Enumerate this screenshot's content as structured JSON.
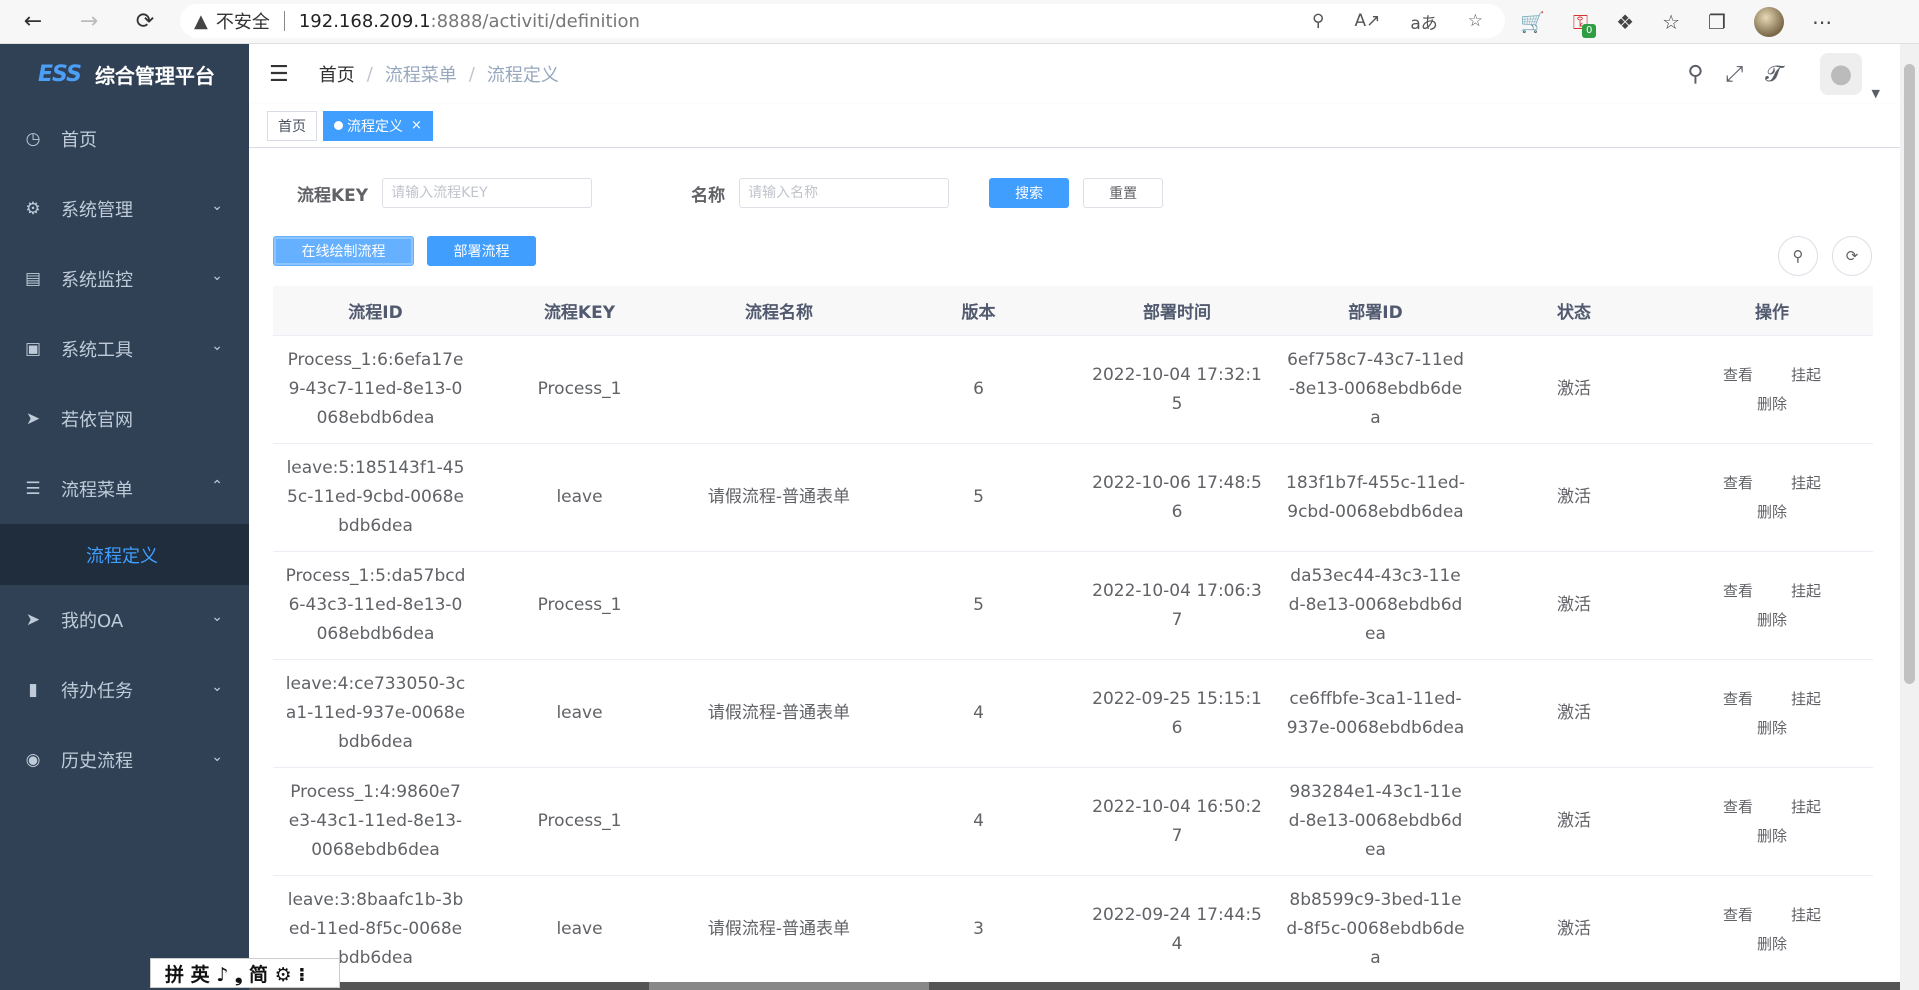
{
  "browser": {
    "insecure_label": "不安全",
    "url_host": "192.168.209.1",
    "url_rest": ":8888/activiti/definition",
    "ext_badge_count": "0"
  },
  "sidebar": {
    "logo_mark": "ESS",
    "logo_text": "综合管理平台",
    "items": [
      {
        "label": "首页",
        "icon": "dashboard-icon"
      },
      {
        "label": "系统管理",
        "icon": "gear-icon"
      },
      {
        "label": "系统监控",
        "icon": "monitor-icon"
      },
      {
        "label": "系统工具",
        "icon": "toolbox-icon"
      },
      {
        "label": "若依官网",
        "icon": "send-icon"
      },
      {
        "label": "流程菜单",
        "icon": "tree-icon"
      },
      {
        "label": "我的OA",
        "icon": "send-icon"
      },
      {
        "label": "待办任务",
        "icon": "book-icon"
      },
      {
        "label": "历史流程",
        "icon": "eye-icon"
      }
    ],
    "active_sub": "流程定义"
  },
  "header": {
    "breadcrumb": [
      "首页",
      "流程菜单",
      "流程定义"
    ],
    "separator": "/"
  },
  "tags": {
    "home": "首页",
    "active": "流程定义",
    "close": "×"
  },
  "search": {
    "key_label": "流程KEY",
    "key_placeholder": "请输入流程KEY",
    "name_label": "名称",
    "name_placeholder": "请输入名称",
    "search_button": "搜索",
    "reset_button": "重置"
  },
  "toolbar": {
    "draw_button": "在线绘制流程",
    "deploy_button": "部署流程"
  },
  "table": {
    "columns": [
      "流程ID",
      "流程KEY",
      "流程名称",
      "版本",
      "部署时间",
      "部署ID",
      "状态",
      "操作"
    ],
    "ops": {
      "view": "查看",
      "suspend": "挂起",
      "delete": "删除"
    },
    "rows": [
      {
        "id": "Process_1:6:6efa17e9-43c7-11ed-8e13-0068ebdb6dea",
        "key": "Process_1",
        "name": "",
        "version": "6",
        "time": "2022-10-04 17:32:15",
        "deploy_id": "6ef758c7-43c7-11ed-8e13-0068ebdb6dea",
        "status": "激活"
      },
      {
        "id": "leave:5:185143f1-455c-11ed-9cbd-0068ebdb6dea",
        "key": "leave",
        "name": "请假流程-普通表单",
        "version": "5",
        "time": "2022-10-06 17:48:56",
        "deploy_id": "183f1b7f-455c-11ed-9cbd-0068ebdb6dea",
        "status": "激活"
      },
      {
        "id": "Process_1:5:da57bcd6-43c3-11ed-8e13-0068ebdb6dea",
        "key": "Process_1",
        "name": "",
        "version": "5",
        "time": "2022-10-04 17:06:37",
        "deploy_id": "da53ec44-43c3-11ed-8e13-0068ebdb6dea",
        "status": "激活"
      },
      {
        "id": "leave:4:ce733050-3ca1-11ed-937e-0068ebdb6dea",
        "key": "leave",
        "name": "请假流程-普通表单",
        "version": "4",
        "time": "2022-09-25 15:15:16",
        "deploy_id": "ce6ffbfe-3ca1-11ed-937e-0068ebdb6dea",
        "status": "激活"
      },
      {
        "id": "Process_1:4:9860e7e3-43c1-11ed-8e13-0068ebdb6dea",
        "key": "Process_1",
        "name": "",
        "version": "4",
        "time": "2022-10-04 16:50:27",
        "deploy_id": "983284e1-43c1-11ed-8e13-0068ebdb6dea",
        "status": "激活"
      },
      {
        "id": "leave:3:8baafc1b-3bed-11ed-8f5c-0068ebdb6dea",
        "key": "leave",
        "name": "请假流程-普通表单",
        "version": "3",
        "time": "2022-09-24 17:44:54",
        "deploy_id": "8b8599c9-3bed-11ed-8f5c-0068ebdb6dea",
        "status": "激活"
      }
    ]
  },
  "ime": {
    "text": "拼 英 ♪ ❟ 简 ⚙ ⁝"
  },
  "colors": {
    "sidebar_bg": "#304156",
    "accent": "#409eff",
    "submenu_bg": "#1f2d3d"
  }
}
